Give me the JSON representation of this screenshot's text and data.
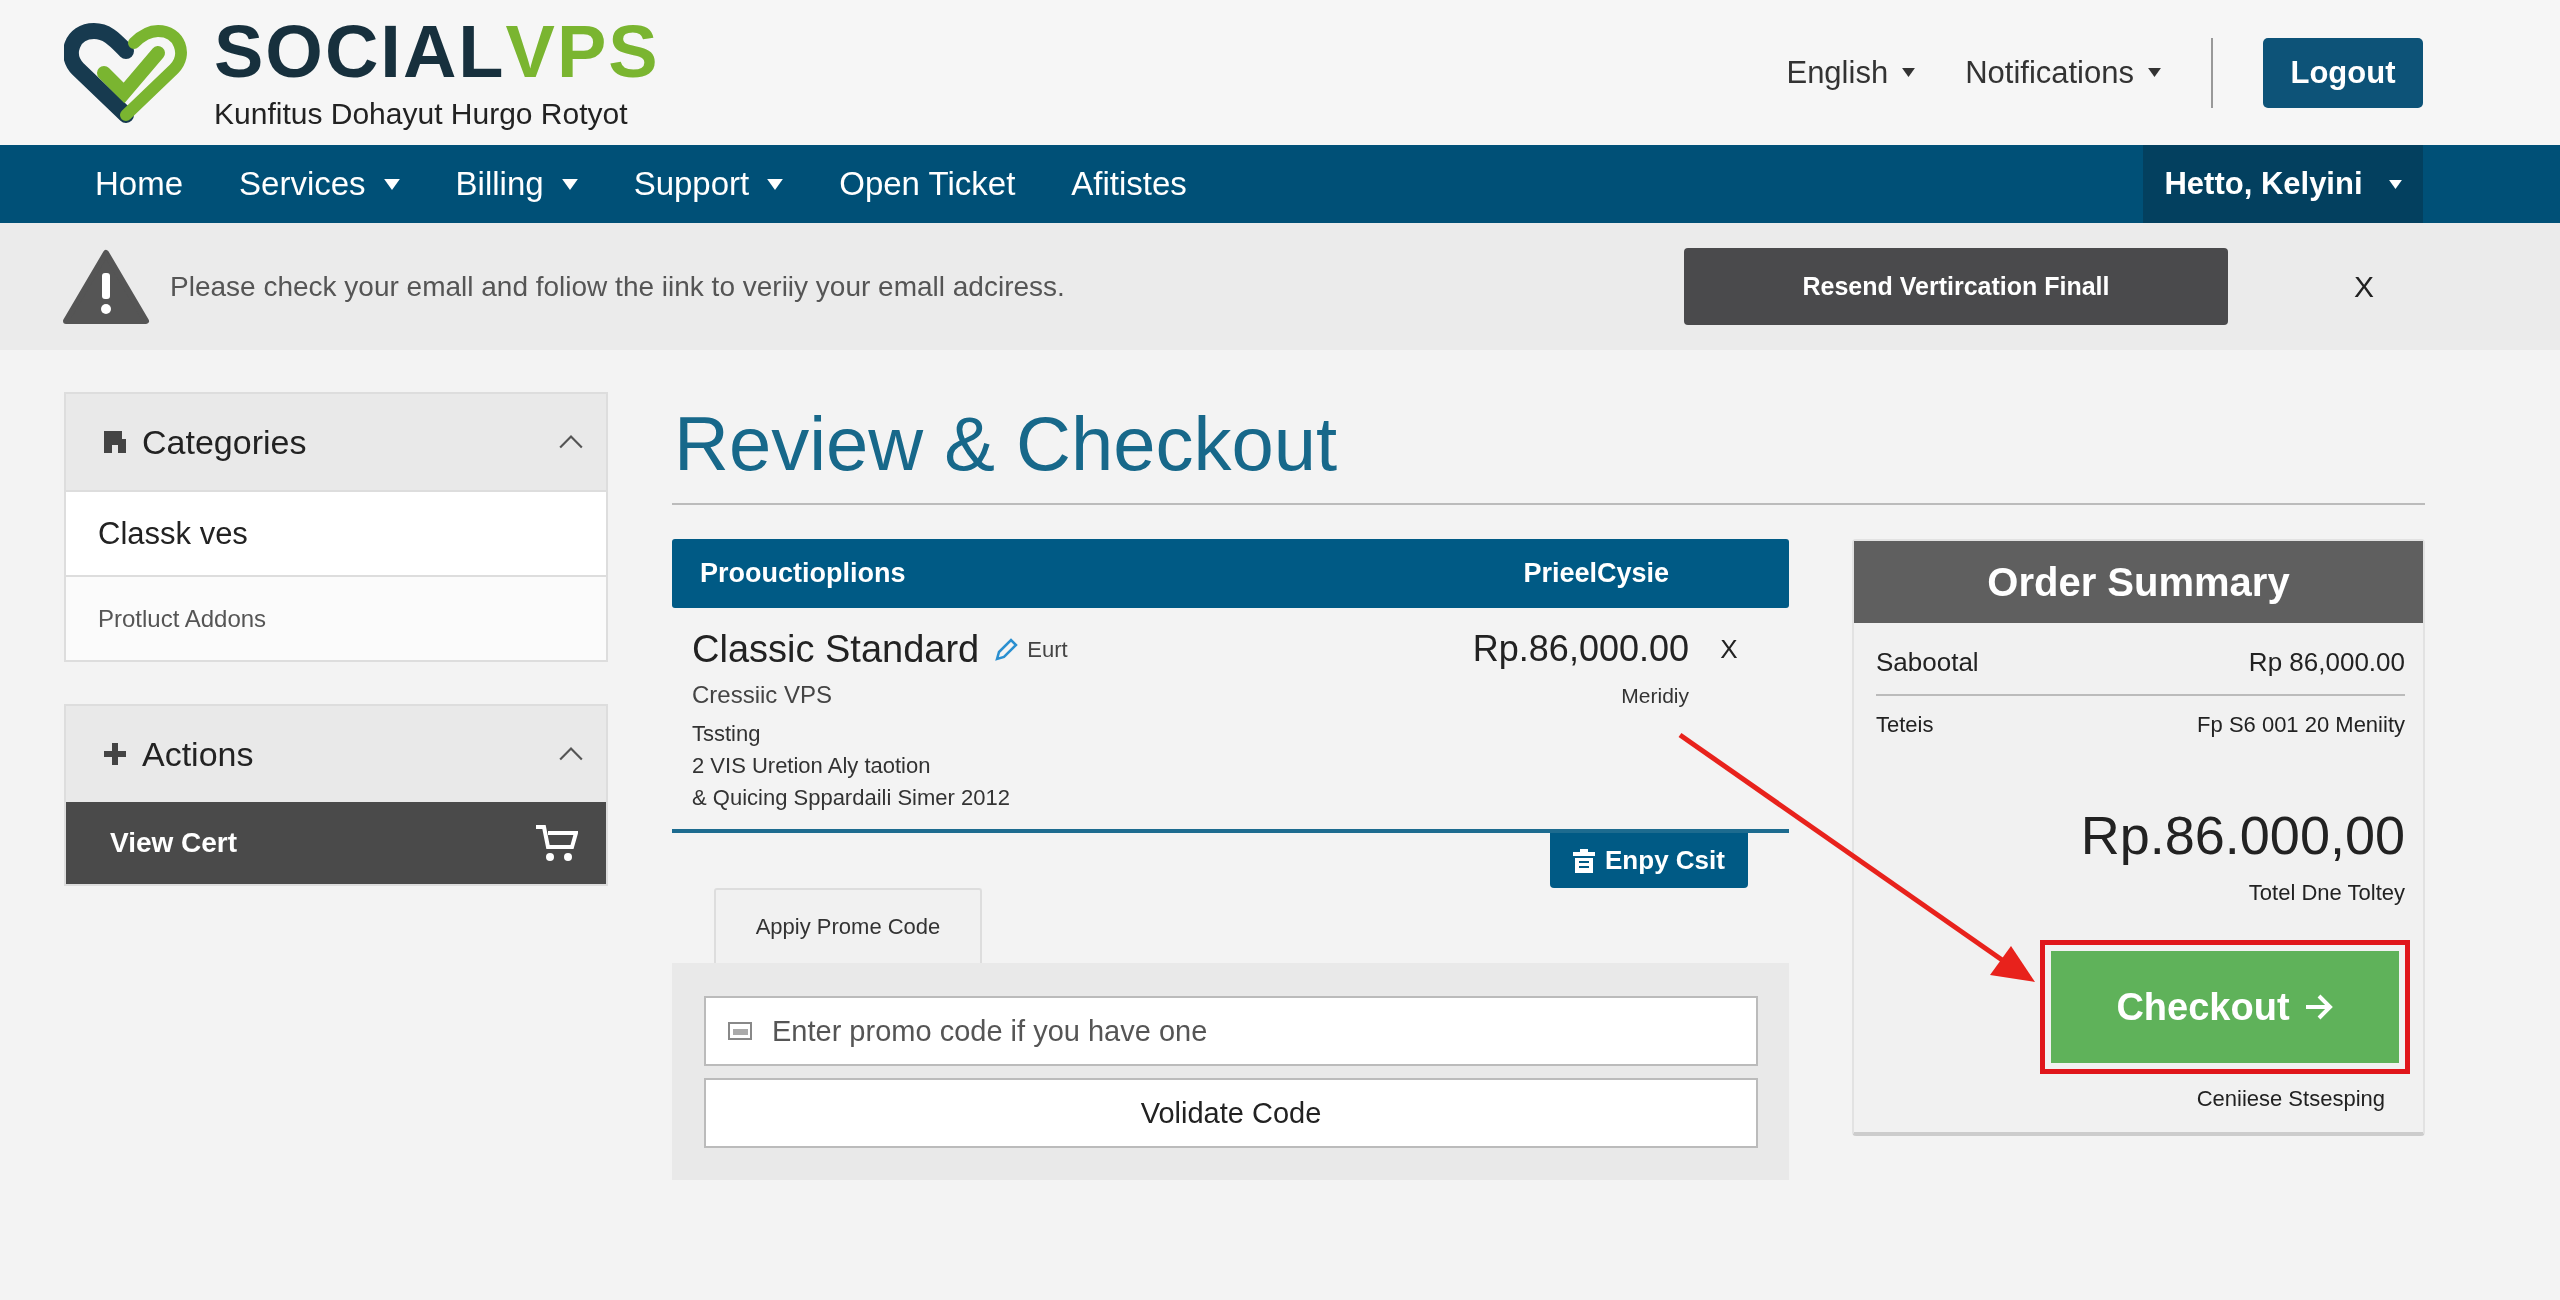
{
  "header": {
    "brand": {
      "name_primary": "SOCIAL",
      "name_accent": "VPS",
      "tagline": "Kunfitus Dohayut Hurgo Rotyot"
    },
    "links": [
      {
        "label": "English"
      },
      {
        "label": "Notifications"
      }
    ],
    "logout": "Logout"
  },
  "nav": {
    "items": [
      {
        "label": "Home",
        "dropdown": false
      },
      {
        "label": "Services",
        "dropdown": true
      },
      {
        "label": "Billing",
        "dropdown": true
      },
      {
        "label": "Support",
        "dropdown": true
      },
      {
        "label": "Open Ticket",
        "dropdown": false
      },
      {
        "label": "Afitistes",
        "dropdown": false
      }
    ],
    "user_menu": "Hetto, Kelyini"
  },
  "alert": {
    "message": "Please check your emall and foliow the iink to veriiy your emall adciress.",
    "button": "Resend Vertircation Finall",
    "close": "X"
  },
  "sidebar": {
    "categories": {
      "title": "Categories",
      "expanded": true,
      "items": [
        {
          "label": "Classk ves",
          "selected": true
        },
        {
          "label": "Protluct Addons",
          "selected": false
        }
      ]
    },
    "actions": {
      "title": "Actions",
      "expanded": true,
      "items": [
        {
          "label": "View Cert"
        }
      ]
    }
  },
  "page_title": "Review & Checkout",
  "cart": {
    "columns": [
      "Proouctioplions",
      "PrieelCysie"
    ],
    "items": [
      {
        "name": "Classic Standard",
        "edit": "Eurt",
        "group": "Cressiic VPS",
        "details": [
          "Tssting",
          "2 VIS Uretion Aly taotion",
          "& Quicing Sppardaili Simer 2012"
        ],
        "price": "Rp.86,000.00",
        "cycle": "Meridiy",
        "remove": "X"
      }
    ],
    "empty_button": "Enpy Csit"
  },
  "promo": {
    "tab": "Appiy Prome Code",
    "placeholder": "Enter promo code if you have one",
    "button": "Volidate Code"
  },
  "summary": {
    "title": "Order Summary",
    "rows": [
      {
        "label": "Sabootal",
        "value": "Rp 86,000.00"
      },
      {
        "label": "Teteis",
        "value": "Fp S6 001 20 Meniity"
      }
    ],
    "total": "Rp.86.000,00",
    "total_label": "Totel Dne Toltey",
    "checkout": {
      "label": "Checkout",
      "highlighted": true
    },
    "note": "Ceniiese Stsesping"
  }
}
